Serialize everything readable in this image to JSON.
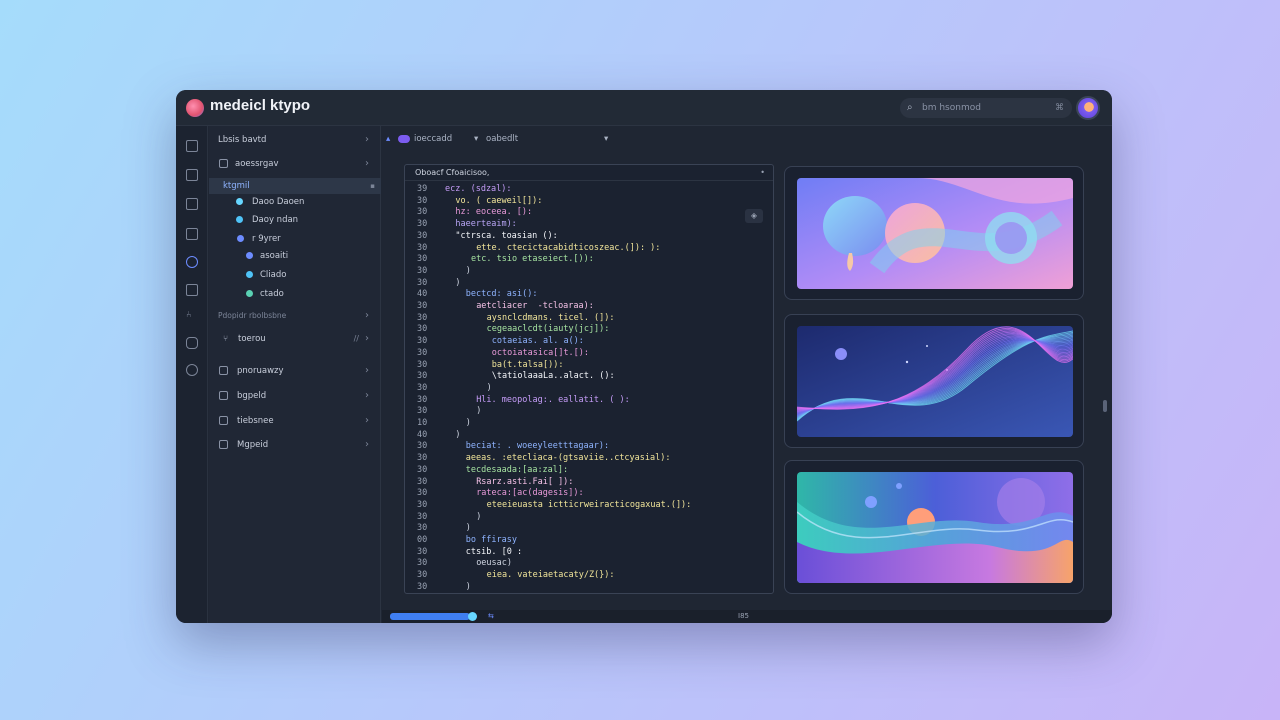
{
  "app": {
    "title": "medeicl ktypo",
    "search": {
      "placeholder": "bm  hsonmod",
      "shortcut": "⌘"
    }
  },
  "sidebar": {
    "items": [
      {
        "label": "Lbsis bavtd"
      },
      {
        "label": "aoessrgav"
      },
      {
        "label": "ktgmil"
      },
      {
        "label": "Daoo Daoen"
      },
      {
        "label": "Daoy ndan"
      },
      {
        "label": "r  9yrer"
      },
      {
        "label": "asoaiti"
      },
      {
        "label": "Cliado"
      },
      {
        "label": "ctado"
      },
      {
        "label": "Pdopidr rbolbsbne"
      },
      {
        "label": "toerou",
        "extra": "//"
      },
      {
        "label": "pnoruawzy"
      },
      {
        "label": "bgpeld"
      },
      {
        "label": "tiebsnee"
      },
      {
        "label": "Mgpeid"
      }
    ]
  },
  "breadcrumb": {
    "items": [
      "ioeccadd",
      "▾",
      "oabedlt",
      "▾"
    ]
  },
  "editor": {
    "tab_title": "Oboacf Cfoaicisoo,",
    "close_icon": "close-icon",
    "fab": "◈",
    "lines": [
      {
        "n": "39",
        "text": "ecz. (sdzal):",
        "indent": 0,
        "color": "#c59cf7"
      },
      {
        "n": "30",
        "text": "vo. ( caeweil[]):",
        "indent": 2,
        "color": "#f1e59a"
      },
      {
        "n": "30",
        "text": "hz: eoceea. [):",
        "indent": 2,
        "color": "#e89ad9"
      },
      {
        "n": "30",
        "text": "haeerteaim):",
        "indent": 2,
        "color": "#b8a5f5"
      },
      {
        "n": "30",
        "text": "\"ctrsca. toasian ():",
        "indent": 2,
        "color": "#f5f7fb"
      },
      {
        "n": "30",
        "text": "ette. ctecictacabidticoszeac.(]): ):",
        "indent": 6,
        "color": "#f1e59a"
      },
      {
        "n": "30",
        "text": "etc. tsio etaseiect.[)):",
        "indent": 5,
        "color": "#a6e3a1"
      },
      {
        "n": "30",
        "text": ")",
        "indent": 4,
        "color": "#cfd5e1"
      },
      {
        "n": "30",
        "text": ")",
        "indent": 2,
        "color": "#cfd5e1"
      },
      {
        "n": "40",
        "text": "bectcd: asi():",
        "indent": 4,
        "color": "#8fb4ff"
      },
      {
        "n": "30",
        "text": "aetcliacer  -tcloaraa):",
        "indent": 6,
        "color": "#f5c2e7"
      },
      {
        "n": "30",
        "text": "aysnclcdmans. ticel. (]):",
        "indent": 8,
        "color": "#f1e59a"
      },
      {
        "n": "30",
        "text": "cegeaaclcdt(iauty(jcj]):",
        "indent": 8,
        "color": "#a6e3a1"
      },
      {
        "n": "30",
        "text": "cotaeias. al. a():",
        "indent": 9,
        "color": "#8fb4ff"
      },
      {
        "n": "30",
        "text": "octoiatasica[]t.[):",
        "indent": 9,
        "color": "#e89ad9"
      },
      {
        "n": "30",
        "text": "ba(t.talsa[)):",
        "indent": 9,
        "color": "#f1e59a"
      },
      {
        "n": "30",
        "text": "\\tatiolaaaLa..alact. ():",
        "indent": 9,
        "color": "#f5f7fb"
      },
      {
        "n": "30",
        "text": ")",
        "indent": 8,
        "color": "#cfd5e1"
      },
      {
        "n": "30",
        "text": "Hli. meopolag:. eallatit. ( ):",
        "indent": 6,
        "color": "#c59cf7"
      },
      {
        "n": "30",
        "text": ")",
        "indent": 6,
        "color": "#cfd5e1"
      },
      {
        "n": "10",
        "text": ")",
        "indent": 4,
        "color": "#cfd5e1"
      },
      {
        "n": "40",
        "text": ")",
        "indent": 2,
        "color": "#cfd5e1"
      },
      {
        "n": "30",
        "text": "beciat: . woeeyleetttagaar):",
        "indent": 4,
        "color": "#8fb4ff"
      },
      {
        "n": "30",
        "text": "aeeas. :etecliaca-(gtsaviie..ctcyasial):",
        "indent": 4,
        "color": "#f1e59a"
      },
      {
        "n": "30",
        "text": "tecdesaada:[aa:zal]:",
        "indent": 4,
        "color": "#a6e3a1"
      },
      {
        "n": "30",
        "text": "Rsarz.asti.Fai[ ]):",
        "indent": 6,
        "color": "#f5c2e7"
      },
      {
        "n": "30",
        "text": "rateca:[ac(dagesis]):",
        "indent": 6,
        "color": "#e89ad9"
      },
      {
        "n": "30",
        "text": "eteeieuasta ictticrweiracticogaxuat.(]):",
        "indent": 8,
        "color": "#f1e59a"
      },
      {
        "n": "30",
        "text": ")",
        "indent": 6,
        "color": "#cfd5e1"
      },
      {
        "n": "30",
        "text": ")",
        "indent": 4,
        "color": "#cfd5e1"
      },
      {
        "n": "00",
        "text": "bo ffirasy",
        "indent": 4,
        "color": "#8fb4ff"
      },
      {
        "n": "30",
        "text": "ctsib. [0 :",
        "indent": 4,
        "color": "#f5f7fb"
      },
      {
        "n": "30",
        "text": "oeusac)",
        "indent": 6,
        "color": "#cfd5e1"
      },
      {
        "n": "30",
        "text": "eiea. vateiaetacaty/Z(}):",
        "indent": 8,
        "color": "#f1e59a"
      },
      {
        "n": "30",
        "text": ")",
        "indent": 4,
        "color": "#cfd5e1"
      }
    ]
  },
  "status": {
    "center": "I85",
    "right": "• • • •",
    "icon": "⇆"
  },
  "colors": {
    "accent": "#6d8cff",
    "window_bg": "#1f2633"
  }
}
